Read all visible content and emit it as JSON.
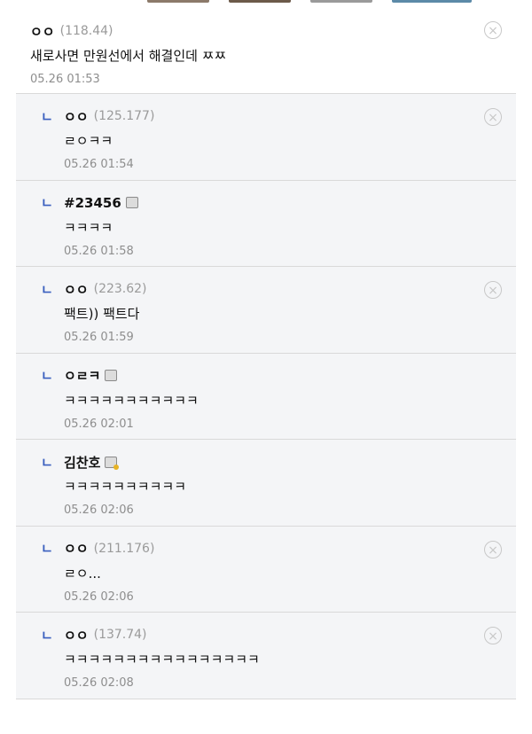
{
  "comments": [
    {
      "kind": "parent",
      "nick": "ㅇㅇ",
      "ip": "(118.44)",
      "text": "새로사면 만원선에서 해결인데 ㅉㅉ",
      "time": "05.26 01:53",
      "deletable": true,
      "member": null
    },
    {
      "kind": "reply",
      "mark": "ㄴ",
      "nick": "ㅇㅇ",
      "ip": "(125.177)",
      "text": "ㄹㅇㅋㅋ",
      "time": "05.26 01:54",
      "deletable": true,
      "member": null
    },
    {
      "kind": "reply",
      "mark": "ㄴ",
      "nick": "#23456",
      "ip": "",
      "text": "ㅋㅋㅋㅋ",
      "time": "05.26 01:58",
      "deletable": false,
      "member": "gray"
    },
    {
      "kind": "reply",
      "mark": "ㄴ",
      "nick": "ㅇㅇ",
      "ip": "(223.62)",
      "text": "팩트)) 팩트다",
      "time": "05.26 01:59",
      "deletable": true,
      "member": null
    },
    {
      "kind": "reply",
      "mark": "ㄴ",
      "nick": "ㅇㄹㅋ",
      "ip": "",
      "text": "ㅋㅋㅋㅋㅋㅋㅋㅋㅋㅋㅋ",
      "time": "05.26 02:01",
      "deletable": false,
      "member": "gray"
    },
    {
      "kind": "reply",
      "mark": "ㄴ",
      "nick": "김찬호",
      "ip": "",
      "text": "ㅋㅋㅋㅋㅋㅋㅋㅋㅋㅋ",
      "time": "05.26 02:06",
      "deletable": false,
      "member": "gold"
    },
    {
      "kind": "reply",
      "mark": "ㄴ",
      "nick": "ㅇㅇ",
      "ip": "(211.176)",
      "text": "ㄹㅇ...",
      "time": "05.26 02:06",
      "deletable": true,
      "member": null
    },
    {
      "kind": "reply",
      "mark": "ㄴ",
      "nick": "ㅇㅇ",
      "ip": "(137.74)",
      "text": "ㅋㅋㅋㅋㅋㅋㅋㅋㅋㅋㅋㅋㅋㅋㅋㅋ",
      "time": "05.26 02:08",
      "deletable": true,
      "member": null
    }
  ],
  "icons": {
    "delete": "⊗",
    "delete_name": "delete-circle-icon"
  },
  "colors": {
    "reply_mark": "#3a5fbf",
    "reply_bg": "#f4f5f7",
    "ip_text": "#9a9a9a",
    "time_text": "#8e8e8e"
  }
}
